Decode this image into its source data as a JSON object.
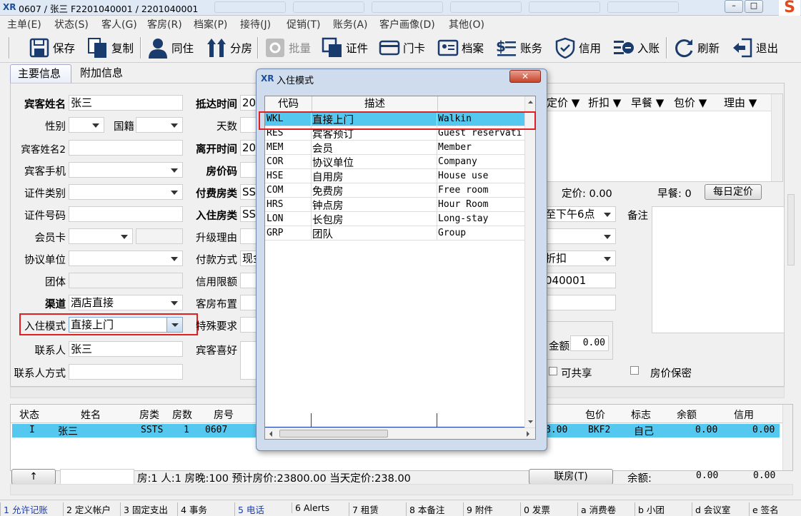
{
  "title": "0607 / 张三 F2201040001 / 2201040001",
  "menu": [
    "主单(E)",
    "状态(S)",
    "客人(G)",
    "客房(R)",
    "档案(P)",
    "接待(J)",
    "促销(T)",
    "账务(A)",
    "客户画像(D)",
    "其他(O)"
  ],
  "toolbar": [
    {
      "label": "保存",
      "icon": "save-icon"
    },
    {
      "label": "复制",
      "icon": "copy-icon"
    },
    {
      "label": "同住",
      "icon": "person-icon"
    },
    {
      "label": "分房",
      "icon": "split-room-icon"
    },
    {
      "label": "批量",
      "icon": "batch-icon"
    },
    {
      "label": "证件",
      "icon": "id-icon"
    },
    {
      "label": "门卡",
      "icon": "card-icon"
    },
    {
      "label": "档案",
      "icon": "profile-icon"
    },
    {
      "label": "账务",
      "icon": "account-icon"
    },
    {
      "label": "信用",
      "icon": "credit-icon"
    },
    {
      "label": "入账",
      "icon": "post-icon"
    },
    {
      "label": "刷新",
      "icon": "refresh-icon"
    },
    {
      "label": "退出",
      "icon": "exit-icon"
    }
  ],
  "tabs": [
    "主要信息",
    "附加信息"
  ],
  "form": {
    "guest_name_label": "宾客姓名",
    "guest_name": "张三",
    "gender_label": "性别",
    "nationality_label": "国籍",
    "guest_name2_label": "宾客姓名2",
    "mobile_label": "宾客手机",
    "id_type_label": "证件类别",
    "id_no_label": "证件号码",
    "member_card_label": "会员卡",
    "agreement_label": "协议单位",
    "group_label": "团体",
    "channel_label": "渠道",
    "channel": "酒店直接",
    "checkin_mode_label": "入住模式",
    "checkin_mode": "直接上门",
    "contact_label": "联系人",
    "contact": "张三",
    "contact_method_label": "联系人方式",
    "arrival_label": "抵达时间",
    "arrival": "20",
    "days_label": "天数",
    "departure_label": "离开时间",
    "departure": "20",
    "rate_code_label": "房价码",
    "pay_room_type_label": "付费房类",
    "pay_room_type": "SST",
    "checkin_room_type_label": "入住房类",
    "checkin_room_type": "SST",
    "upgrade_label": "升级理由",
    "pay_method_label": "付款方式",
    "pay_method": "现金",
    "credit_limit_label": "信用限额",
    "room_layout_label": "客房布置",
    "special_label": "特殊要求",
    "preference_label": "宾客喜好"
  },
  "right": {
    "headers": [
      "定价 ▼",
      "折扣 ▼",
      "早餐 ▼",
      "包价 ▼",
      "理由 ▼"
    ],
    "rate_text": "定价: 0.00",
    "breakfast_text": "早餐: 0",
    "daily_rate_btn": "每日定价",
    "until_text": "至下午6点",
    "discount_text": "折扣",
    "account_no": "040001",
    "remark_label": "备注",
    "balance_label": "金额",
    "balance": "0.00",
    "shareable": "可共享",
    "rate_confidential": "房价保密"
  },
  "dialog": {
    "title": "入住模式",
    "close": "✕",
    "columns": [
      "代码",
      "描述",
      ""
    ],
    "rows": [
      {
        "code": "WKL",
        "desc": "直接上门",
        "en": "Walkin"
      },
      {
        "code": "RES",
        "desc": "宾客预订",
        "en": "Guest reservati"
      },
      {
        "code": "MEM",
        "desc": "会员",
        "en": "Member"
      },
      {
        "code": "COR",
        "desc": "协议单位",
        "en": "Company"
      },
      {
        "code": "HSE",
        "desc": "自用房",
        "en": "House use"
      },
      {
        "code": "COM",
        "desc": "免费房",
        "en": "Free room"
      },
      {
        "code": "HRS",
        "desc": "钟点房",
        "en": "Hour Room"
      },
      {
        "code": "LON",
        "desc": "长包房",
        "en": "Long-stay"
      },
      {
        "code": "GRP",
        "desc": "团队",
        "en": "Group"
      }
    ]
  },
  "list": {
    "headers": [
      "状态",
      "姓名",
      "房类",
      "房数",
      "房号",
      "包价",
      "标志",
      "余额",
      "信用"
    ],
    "row": {
      "status": "I",
      "name": "张三",
      "room_type": "SSTS",
      "rooms": "1",
      "room_no": "0607",
      "rate_tail": "8.00",
      "package": "BKF2",
      "flag": "自己",
      "balance": "0.00",
      "credit": "0.00"
    }
  },
  "summary": {
    "up_btn": "↑",
    "text": "房:1  人:1  房晚:100  预计房价:23800.00  当天定价:238.00",
    "link_btn": "联房(T)",
    "balance_label": "余额:",
    "balance": "0.00",
    "credit": "0.00"
  },
  "bottom_tabs": [
    "1 允许记账",
    "2 定义帐户",
    "3 固定支出",
    "4 事务",
    "5 电话",
    "6 Alerts",
    "7 租赁",
    "8 本备注",
    "9 附件",
    "0 发票",
    "a 消费卷",
    "b 小团",
    "d 会议室",
    "e 签名"
  ],
  "colors": {
    "highlight": "#55c8f0",
    "redbox": "#e02020",
    "dialog_border": "#6d87ad"
  }
}
